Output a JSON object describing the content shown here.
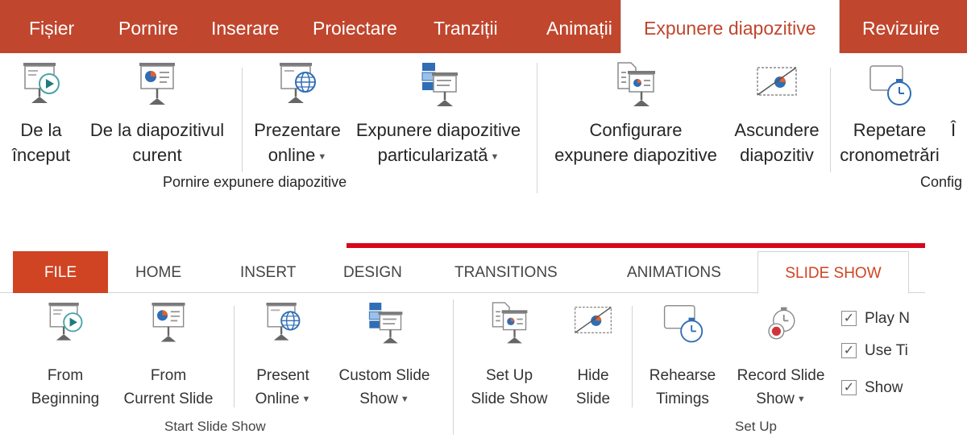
{
  "ro": {
    "tabs": [
      "Fișier",
      "Pornire",
      "Inserare",
      "Proiectare",
      "Tranziții",
      "Animații",
      "Expunere diapozitive",
      "Revizuire"
    ],
    "buttons": {
      "from_start": [
        "De la",
        "început"
      ],
      "from_current": [
        "De la diapozitivul",
        "curent"
      ],
      "online": [
        "Prezentare",
        "online"
      ],
      "custom": [
        "Expunere diapozitive",
        "particularizată"
      ],
      "setup": [
        "Configurare",
        "expunere diapozitive"
      ],
      "hide": [
        "Ascundere",
        "diapozitiv"
      ],
      "rehearse": [
        "Repetare",
        "cronometrări"
      ],
      "cut": [
        "Î",
        ""
      ]
    },
    "groups": {
      "start": "Pornire expunere diapozitive",
      "config": "Config"
    }
  },
  "en": {
    "tabs": [
      "FILE",
      "HOME",
      "INSERT",
      "DESIGN",
      "TRANSITIONS",
      "ANIMATIONS",
      "SLIDE SHOW"
    ],
    "buttons": {
      "from_beginning": [
        "From",
        "Beginning"
      ],
      "from_current": [
        "From",
        "Current Slide"
      ],
      "present_online": [
        "Present",
        "Online"
      ],
      "custom": [
        "Custom Slide",
        "Show"
      ],
      "setup": [
        "Set Up",
        "Slide Show"
      ],
      "hide": [
        "Hide",
        "Slide"
      ],
      "rehearse": [
        "Rehearse",
        "Timings"
      ],
      "record": [
        "Record Slide",
        "Show"
      ]
    },
    "checkboxes": [
      "Play N",
      "Use Ti",
      "Show"
    ],
    "groups": {
      "start": "Start Slide Show",
      "setup": "Set Up"
    }
  },
  "colors": {
    "ro_tabbar": "#c0462d",
    "en_file_tab": "#d04423",
    "accent_line": "#d8061b"
  },
  "icons": [
    "screen-play-icon",
    "screen-pie-icon",
    "screen-globe-icon",
    "custom-show-icon",
    "setup-show-icon",
    "hide-slide-icon",
    "rehearse-timer-icon",
    "record-slide-icon",
    "checkbox-checked-icon"
  ]
}
